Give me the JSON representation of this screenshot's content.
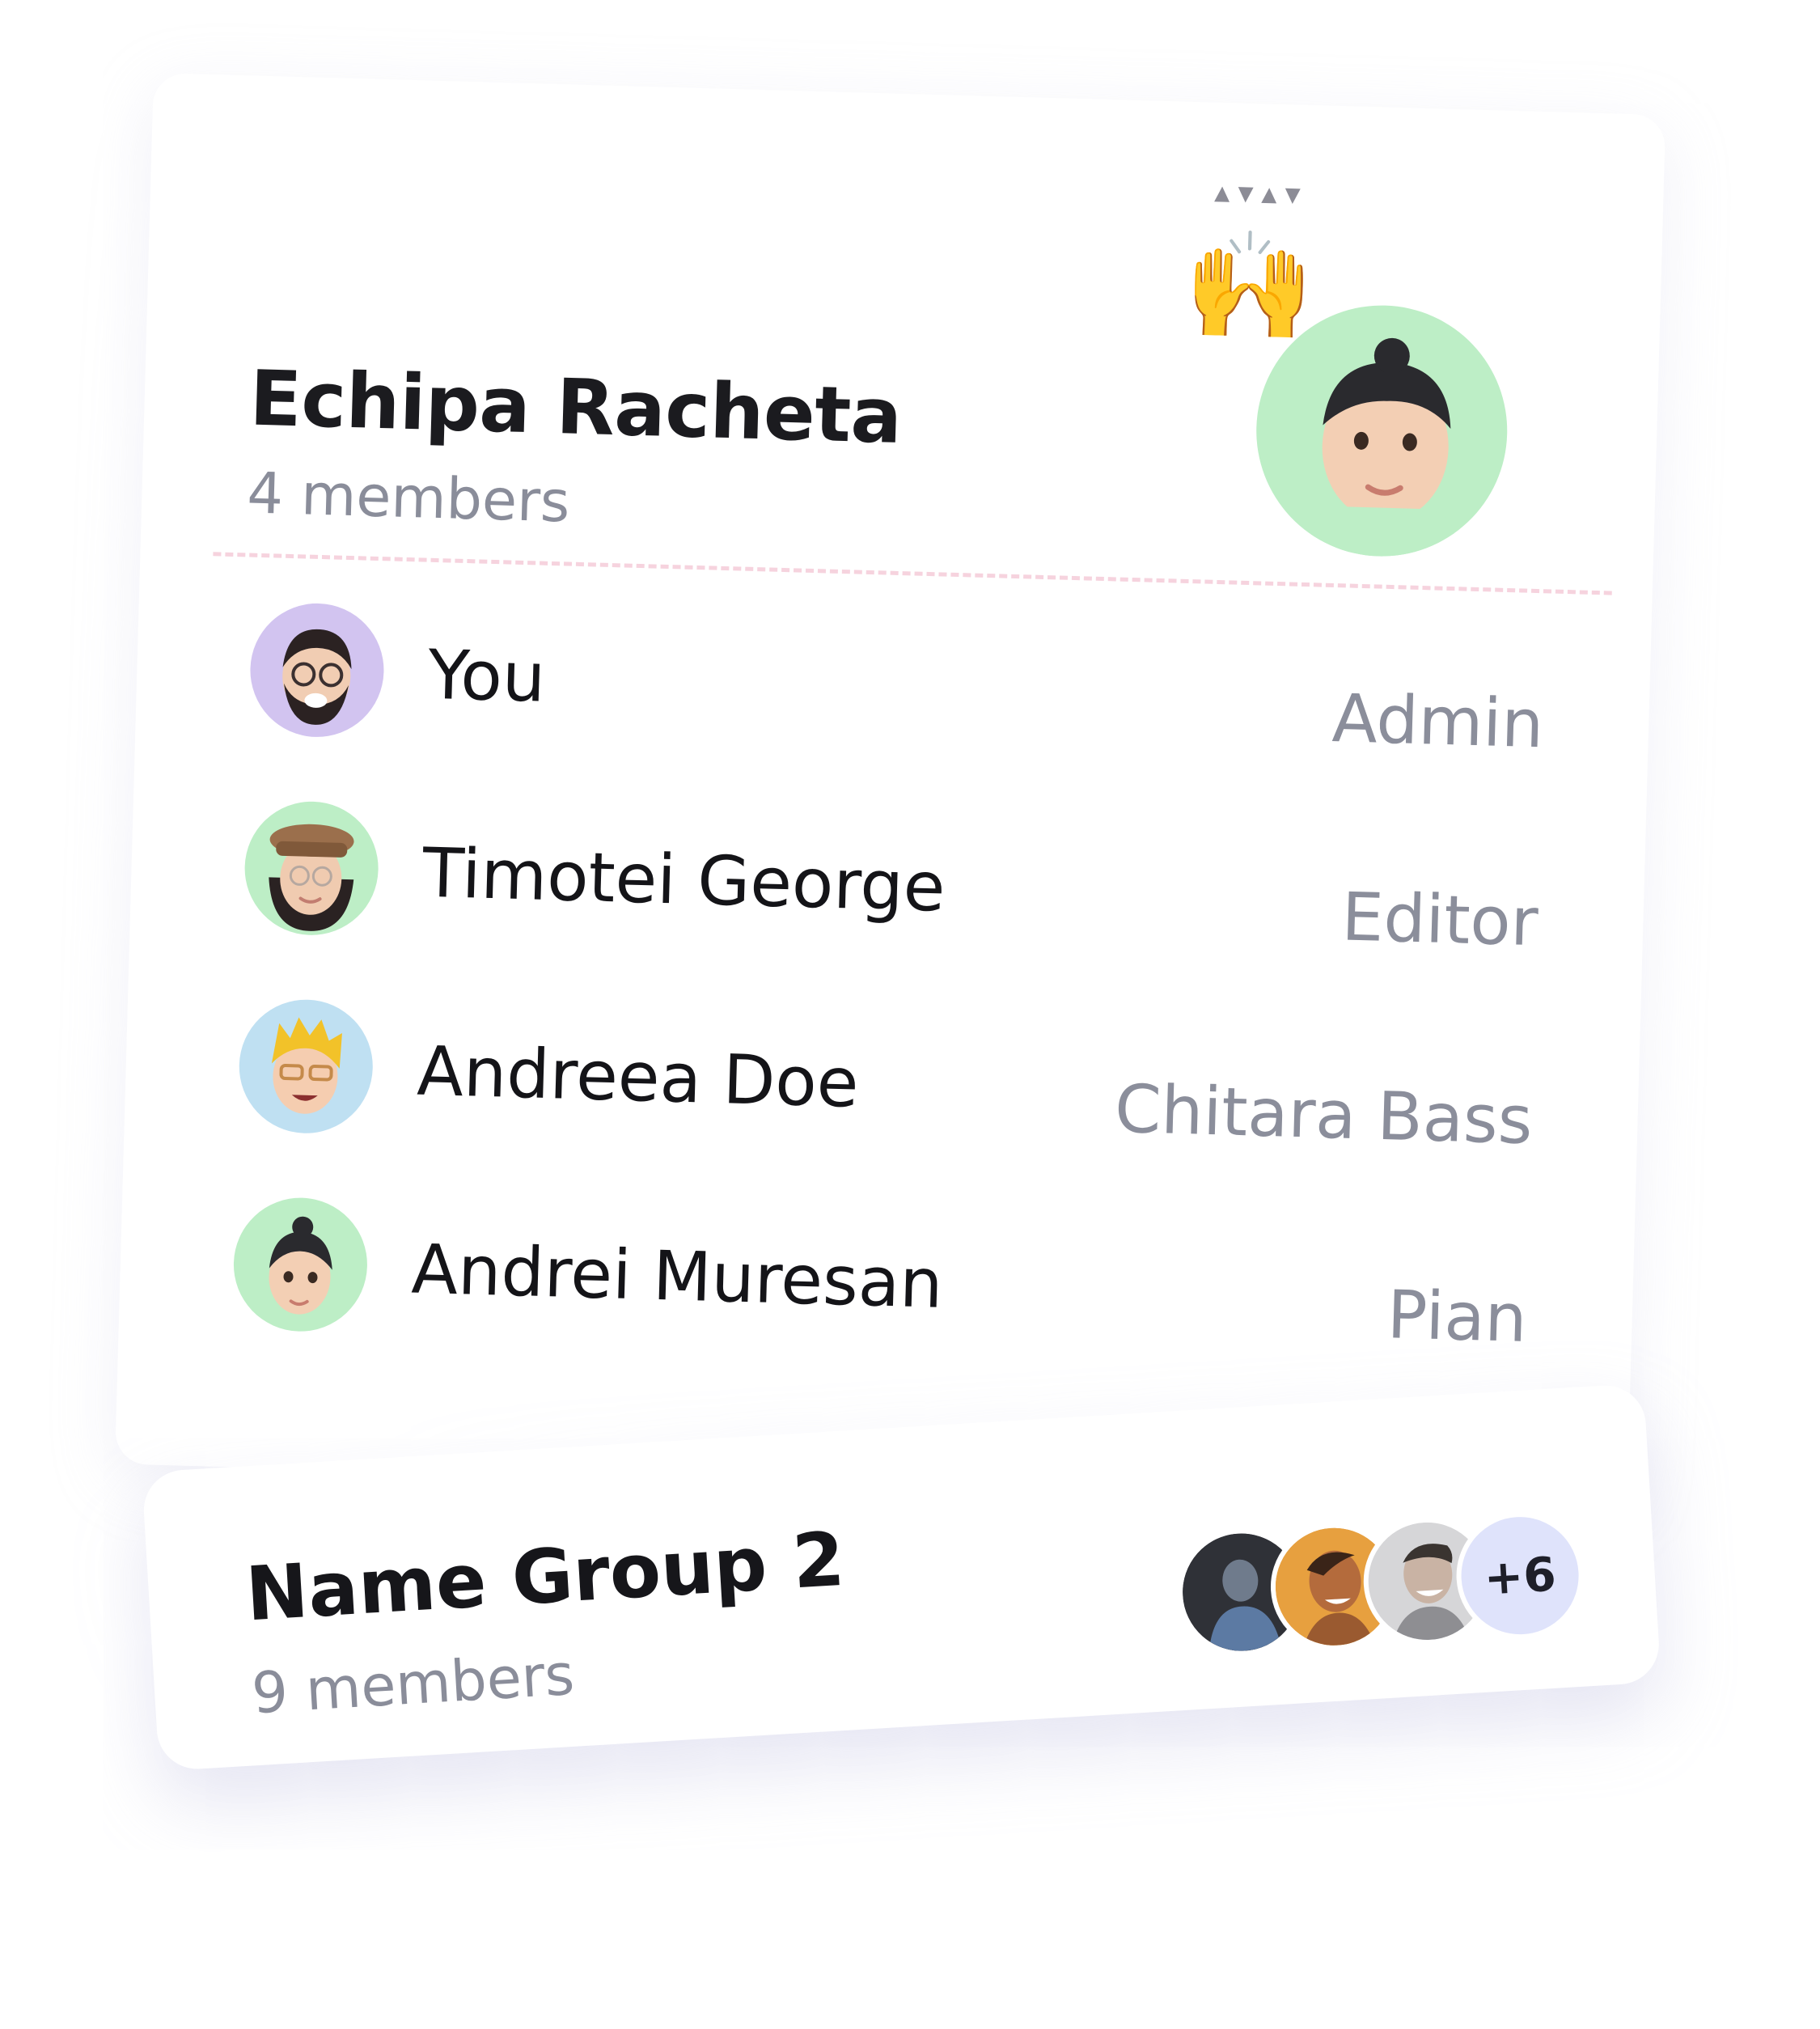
{
  "colors": {
    "accent_green": "#bdeec6",
    "accent_purple": "#d2c4f0",
    "accent_blue": "#bfe0f2",
    "badge_bg": "#dfe3fb",
    "divider": "#f6d3de",
    "muted_text": "#8a8d9a"
  },
  "group": {
    "title": "Echipa Racheta",
    "subtitle": "4 members",
    "hero_emoji": "🙌",
    "hero_avatar_icon": "memoji-avatar-icon"
  },
  "members": [
    {
      "name": "You",
      "role": "Admin",
      "avatar_icon": "memoji-bearded-glasses-icon",
      "avatar_bg": "#d2c4f0"
    },
    {
      "name": "Timotei George",
      "role": "Editor",
      "avatar_icon": "memoji-hat-glasses-icon",
      "avatar_bg": "#bdeec6"
    },
    {
      "name": "Andreea Doe",
      "role": "Chitara Bass",
      "avatar_icon": "memoji-blond-icon",
      "avatar_bg": "#bfe0f2"
    },
    {
      "name": "Andrei Muresan",
      "role": "Pian",
      "avatar_icon": "memoji-bun-icon",
      "avatar_bg": "#bdeec6"
    }
  ],
  "group2": {
    "title": "Name Group 2",
    "subtitle": "9 members",
    "more_count": "+6",
    "avatars": [
      "photo-avatar-1-icon",
      "photo-avatar-2-icon",
      "photo-avatar-3-icon"
    ]
  }
}
